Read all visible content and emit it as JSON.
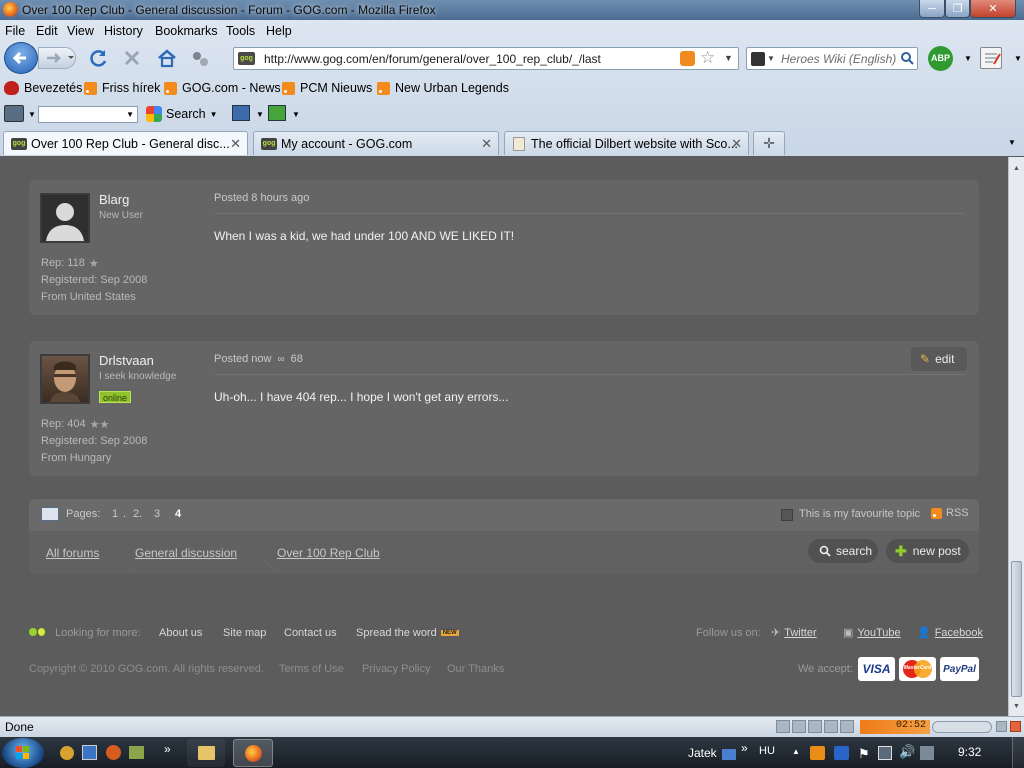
{
  "window": {
    "title": "Over 100 Rep Club - General discussion - Forum - GOG.com - Mozilla Firefox",
    "minimize": "─",
    "maximize": "❐",
    "close": "✕"
  },
  "menu": [
    "File",
    "Edit",
    "View",
    "History",
    "Bookmarks",
    "Tools",
    "Help"
  ],
  "navbar": {
    "url": "http://www.gog.com/en/forum/general/over_100_rep_club/_/last",
    "search_placeholder": "Heroes Wiki (English)"
  },
  "bookmarks": [
    "Bevezetés",
    "Friss hírek",
    "GOG.com - News",
    "PCM Nieuws",
    "New Urban Legends"
  ],
  "toolbar2": {
    "search_label": "Search"
  },
  "tabs": [
    {
      "label": "Over 100 Rep Club - General disc...",
      "close": "✕"
    },
    {
      "label": "My account - GOG.com",
      "close": "✕"
    },
    {
      "label": "The official Dilbert website with Sco...",
      "close": "✕"
    }
  ],
  "posts": [
    {
      "username": "Blarg",
      "rank": "New User",
      "posted": "Posted 8 hours ago",
      "body": "When I was a kid, we had under 100 AND WE LIKED IT!",
      "rep": "Rep: 118",
      "registered": "Registered: Sep 2008",
      "from": "From United States"
    },
    {
      "username": "Drlstvaan",
      "rank": "I seek knowledge",
      "status": "online",
      "posted": "Posted now",
      "reply_count": "68",
      "edit": "edit",
      "body": "Uh-oh... I have 404 rep... I hope I won't get any errors...",
      "rep": "Rep: 404",
      "registered": "Registered: Sep 2008",
      "from": "From Hungary"
    }
  ],
  "pagination": {
    "label": "Pages:",
    "pages": [
      "1",
      "2",
      "3",
      "4"
    ],
    "favourite": "This is my favourite topic",
    "rss": "RSS"
  },
  "breadcrumbs": [
    "All forums",
    "General discussion",
    "Over 100 Rep Club"
  ],
  "actions": {
    "search": "search",
    "new_post": "new post"
  },
  "footer": {
    "looking": "Looking for more:",
    "links": [
      "About us",
      "Site map",
      "Contact us",
      "Spread the word"
    ],
    "new_badge": "NEW",
    "follow": "Follow us on:",
    "social": [
      "Twitter",
      "YouTube",
      "Facebook"
    ],
    "copyright": "Copyright © 2010 GOG.com. All rights reserved.",
    "legal": [
      "Terms of Use",
      "Privacy Policy",
      "Our Thanks"
    ],
    "accept": "We accept:",
    "cards": [
      "VISA",
      "MasterCard",
      "PayPal"
    ]
  },
  "statusbar": {
    "text": "Done",
    "time": "02:52"
  },
  "taskbar": {
    "app": "Jatek",
    "lang": "HU",
    "clock": "9:32"
  }
}
